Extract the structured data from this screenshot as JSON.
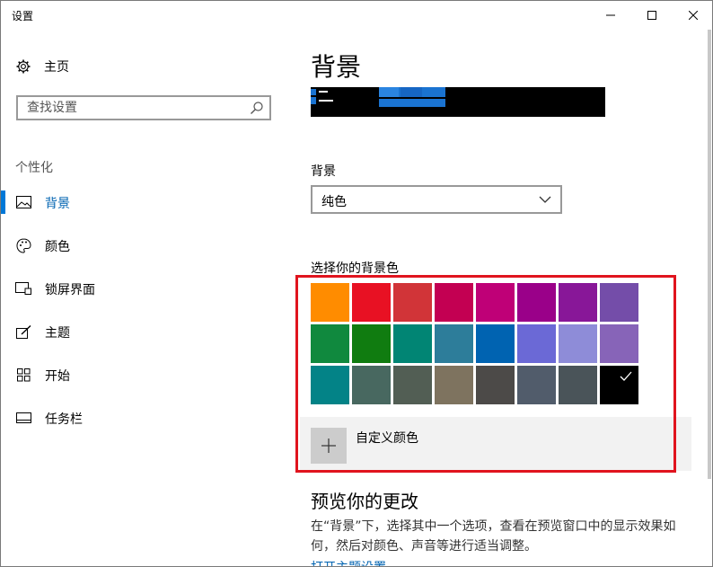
{
  "window": {
    "title": "设置"
  },
  "sidebar": {
    "home_label": "主页",
    "search_placeholder": "查找设置",
    "section_label": "个性化",
    "items": [
      {
        "label": "背景",
        "icon": "picture-icon",
        "selected": true
      },
      {
        "label": "颜色",
        "icon": "palette-icon",
        "selected": false
      },
      {
        "label": "锁屏界面",
        "icon": "lock-screen-icon",
        "selected": false
      },
      {
        "label": "主题",
        "icon": "theme-icon",
        "selected": false
      },
      {
        "label": "开始",
        "icon": "start-icon",
        "selected": false
      },
      {
        "label": "任务栏",
        "icon": "taskbar-icon",
        "selected": false
      }
    ]
  },
  "main": {
    "title": "背景",
    "background_label": "背景",
    "background_value": "纯色",
    "choose_color_label": "选择你的背景色",
    "swatches": [
      "#ff8c00",
      "#e81123",
      "#d13438",
      "#c30052",
      "#bf0077",
      "#9a0089",
      "#881798",
      "#744da9",
      "#10893e",
      "#107c10",
      "#018574",
      "#2d7d9a",
      "#0063b1",
      "#6b69d6",
      "#8e8cd8",
      "#8764b8",
      "#038387",
      "#486860",
      "#525e54",
      "#7e735f",
      "#4c4a48",
      "#515c6b",
      "#4a5459",
      "#000000"
    ],
    "selected_swatch_index": 23,
    "custom_color_label": "自定义颜色",
    "preview_title": "预览你的更改",
    "preview_desc": "在“背景”下，选择其中一个选项，查看在预览窗口中的显示效果如何，然后对颜色、声音等进行适当调整。",
    "theme_link": "打开主题设置"
  },
  "colors": {
    "accent": "#0078d7",
    "highlight_border": "#e0141e"
  }
}
